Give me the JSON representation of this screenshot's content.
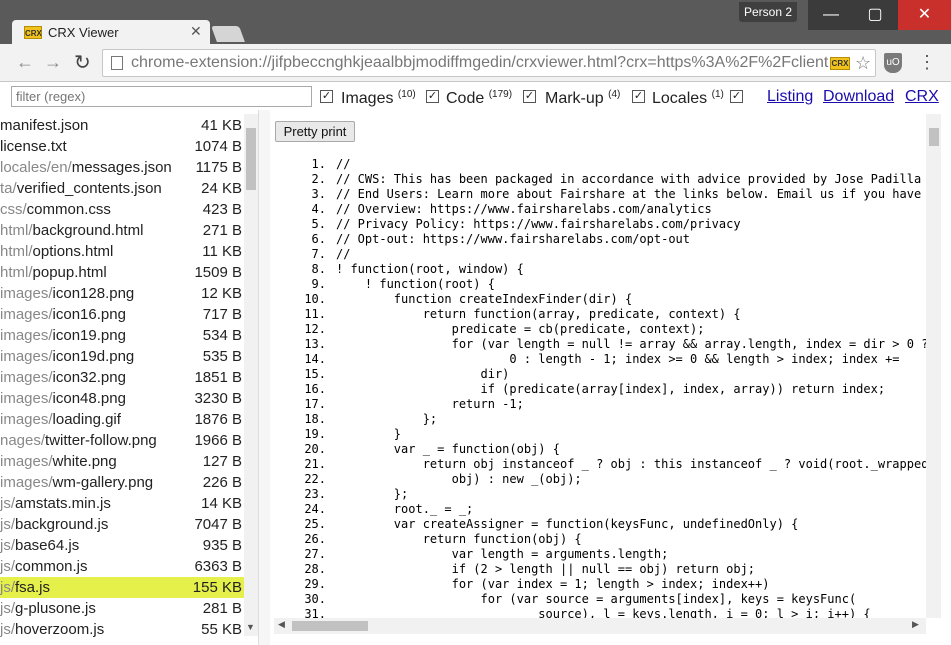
{
  "window": {
    "person": "Person 2",
    "tab_title": "CRX Viewer",
    "tab_favicon": "CRX",
    "url": "chrome-extension://jifpbeccnghkjeaalbbjmodiffmgedin/crxviewer.html?crx=https%3A%2F%2Fclient",
    "omni_crx": "CRX"
  },
  "filterbar": {
    "placeholder": "filter (regex)",
    "checks": [
      {
        "label": "Images",
        "count": "(10)"
      },
      {
        "label": "Code",
        "count": "(179)"
      },
      {
        "label": "Mark-up",
        "count": "(4)"
      },
      {
        "label": "Locales",
        "count": "(1)"
      }
    ],
    "links": {
      "listing": "Listing",
      "download": "Download",
      "crx": "CRX"
    }
  },
  "files": [
    {
      "dir": "",
      "name": "manifest.json",
      "size": "41 KB"
    },
    {
      "dir": "",
      "name": "license.txt",
      "size": "1074 B"
    },
    {
      "dir": "locales/en/",
      "name": "messages.json",
      "size": "1175 B"
    },
    {
      "dir": "ta/",
      "name": "verified_contents.json",
      "size": "24 KB"
    },
    {
      "dir": "css/",
      "name": "common.css",
      "size": "423 B"
    },
    {
      "dir": "html/",
      "name": "background.html",
      "size": "271 B"
    },
    {
      "dir": "html/",
      "name": "options.html",
      "size": "11 KB"
    },
    {
      "dir": "html/",
      "name": "popup.html",
      "size": "1509 B"
    },
    {
      "dir": "images/",
      "name": "icon128.png",
      "size": "12 KB"
    },
    {
      "dir": "images/",
      "name": "icon16.png",
      "size": "717 B"
    },
    {
      "dir": "images/",
      "name": "icon19.png",
      "size": "534 B"
    },
    {
      "dir": "images/",
      "name": "icon19d.png",
      "size": "535 B"
    },
    {
      "dir": "images/",
      "name": "icon32.png",
      "size": "1851 B"
    },
    {
      "dir": "images/",
      "name": "icon48.png",
      "size": "3230 B"
    },
    {
      "dir": "images/",
      "name": "loading.gif",
      "size": "1876 B"
    },
    {
      "dir": "nages/",
      "name": "twitter-follow.png",
      "size": "1966 B"
    },
    {
      "dir": "images/",
      "name": "white.png",
      "size": "127 B"
    },
    {
      "dir": "images/",
      "name": "wm-gallery.png",
      "size": "226 B"
    },
    {
      "dir": "js/",
      "name": "amstats.min.js",
      "size": "14 KB"
    },
    {
      "dir": "js/",
      "name": "background.js",
      "size": "7047 B"
    },
    {
      "dir": "js/",
      "name": "base64.js",
      "size": "935 B"
    },
    {
      "dir": "js/",
      "name": "common.js",
      "size": "6363 B"
    },
    {
      "dir": "js/",
      "name": "fsa.js",
      "size": "155 KB",
      "selected": true
    },
    {
      "dir": "js/",
      "name": "g-plusone.js",
      "size": "281 B"
    },
    {
      "dir": "js/",
      "name": "hoverzoom.js",
      "size": "55 KB"
    }
  ],
  "code": {
    "pretty_label": "Pretty print",
    "lines": [
      {
        "n": "1.",
        "t": "//"
      },
      {
        "n": "2.",
        "t": "// CWS: This has been packaged in accordance with advice provided by Jose Padilla c"
      },
      {
        "n": "3.",
        "t": "// End Users: Learn more about Fairshare at the links below. Email us if you have a"
      },
      {
        "n": "4.",
        "t": "// Overview: https://www.fairsharelabs.com/analytics"
      },
      {
        "n": "5.",
        "t": "// Privacy Policy: https://www.fairsharelabs.com/privacy"
      },
      {
        "n": "6.",
        "t": "// Opt-out: https://www.fairsharelabs.com/opt-out"
      },
      {
        "n": "7.",
        "t": "//"
      },
      {
        "n": "8.",
        "t": "! function(root, window) {"
      },
      {
        "n": "9.",
        "t": "    ! function(root) {"
      },
      {
        "n": "10.",
        "t": "        function createIndexFinder(dir) {"
      },
      {
        "n": "11.",
        "t": "            return function(array, predicate, context) {"
      },
      {
        "n": "12.",
        "t": "                predicate = cb(predicate, context);"
      },
      {
        "n": "13.",
        "t": "                for (var length = null != array && array.length, index = dir > 0 ?"
      },
      {
        "n": "14.",
        "t": "                        0 : length - 1; index >= 0 && length > index; index +="
      },
      {
        "n": "15.",
        "t": "                    dir)"
      },
      {
        "n": "16.",
        "t": "                    if (predicate(array[index], index, array)) return index;"
      },
      {
        "n": "17.",
        "t": "                return -1;"
      },
      {
        "n": "18.",
        "t": "            };"
      },
      {
        "n": "19.",
        "t": "        }"
      },
      {
        "n": "20.",
        "t": "        var _ = function(obj) {"
      },
      {
        "n": "21.",
        "t": "            return obj instanceof _ ? obj : this instanceof _ ? void(root._wrapped"
      },
      {
        "n": "22.",
        "t": "                obj) : new _(obj);"
      },
      {
        "n": "23.",
        "t": "        };"
      },
      {
        "n": "24.",
        "t": "        root._ = _;"
      },
      {
        "n": "25.",
        "t": "        var createAssigner = function(keysFunc, undefinedOnly) {"
      },
      {
        "n": "26.",
        "t": "            return function(obj) {"
      },
      {
        "n": "27.",
        "t": "                var length = arguments.length;"
      },
      {
        "n": "28.",
        "t": "                if (2 > length || null == obj) return obj;"
      },
      {
        "n": "29.",
        "t": "                for (var index = 1; length > index; index++)"
      },
      {
        "n": "30.",
        "t": "                    for (var source = arguments[index], keys = keysFunc("
      },
      {
        "n": "31.",
        "t": "                            source), l = keys.length, i = 0; l > i; i++) {"
      }
    ]
  }
}
